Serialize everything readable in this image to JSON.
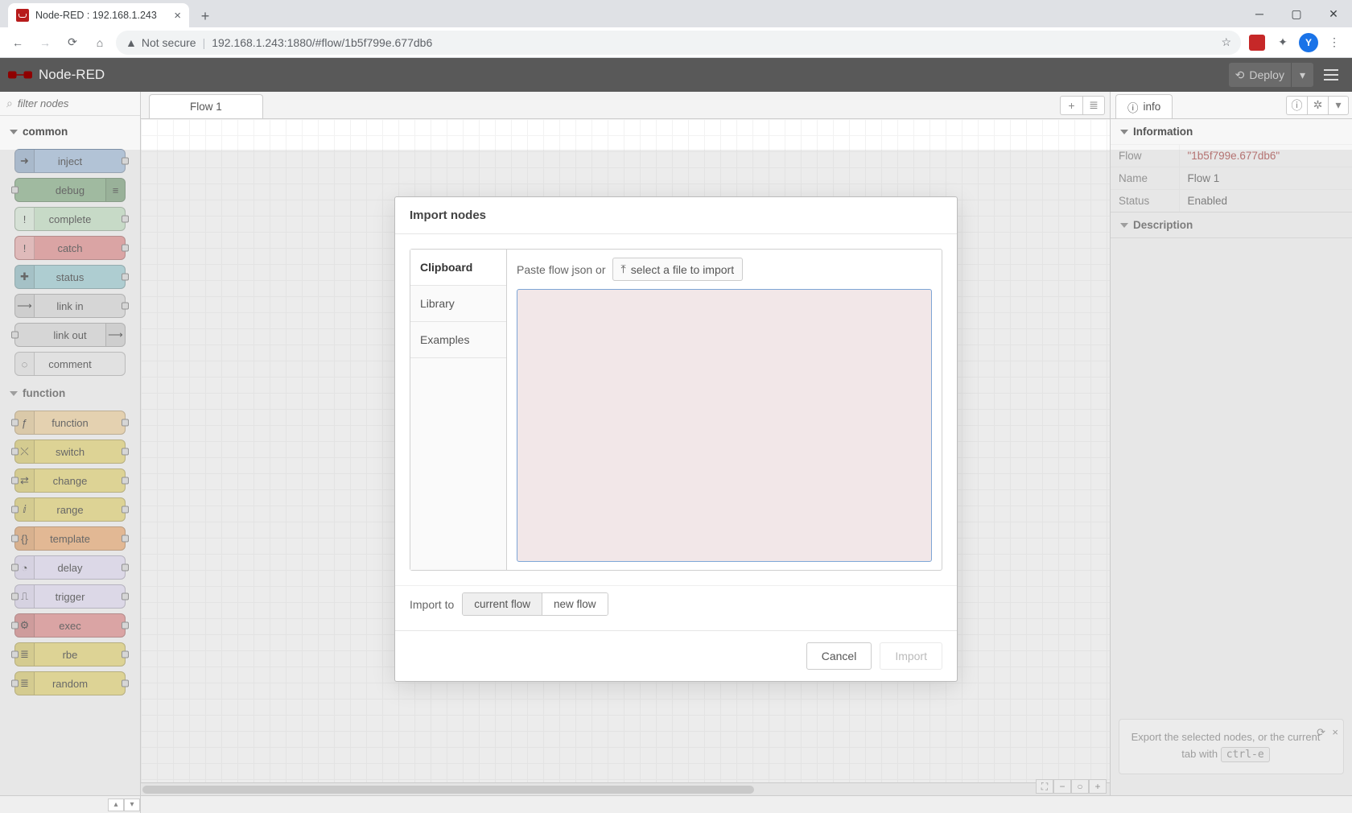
{
  "browser": {
    "tab_title": "Node-RED : 192.168.1.243",
    "not_secure": "Not secure",
    "url": "192.168.1.243:1880/#flow/1b5f799e.677db6",
    "avatar_letter": "Y"
  },
  "header": {
    "product": "Node-RED",
    "deploy": "Deploy"
  },
  "palette": {
    "filter_placeholder": "filter nodes",
    "categories": {
      "common": "common",
      "function": "function"
    },
    "nodes": {
      "inject": "inject",
      "debug": "debug",
      "complete": "complete",
      "catch": "catch",
      "status": "status",
      "link_in": "link in",
      "link_out": "link out",
      "comment": "comment",
      "function": "function",
      "switch": "switch",
      "change": "change",
      "range": "range",
      "template": "template",
      "delay": "delay",
      "trigger": "trigger",
      "exec": "exec",
      "rbe": "rbe",
      "random": "random"
    }
  },
  "workspace": {
    "tab1": "Flow 1"
  },
  "sidebar": {
    "tab_info": "info",
    "section_information": "Information",
    "section_description": "Description",
    "row_flow": "Flow",
    "row_name": "Name",
    "row_status": "Status",
    "flow_id": "\"1b5f799e.677db6\"",
    "name_val": "Flow 1",
    "status_val": "Enabled",
    "hint_a": "Export the selected nodes, or the current tab with ",
    "hint_kbd": "ctrl-e"
  },
  "dialog": {
    "title": "Import nodes",
    "side_clipboard": "Clipboard",
    "side_library": "Library",
    "side_examples": "Examples",
    "paste_label": "Paste flow json or",
    "select_file": "select a file to import",
    "import_to": "Import to",
    "current_flow": "current flow",
    "new_flow": "new flow",
    "cancel": "Cancel",
    "import": "Import"
  }
}
